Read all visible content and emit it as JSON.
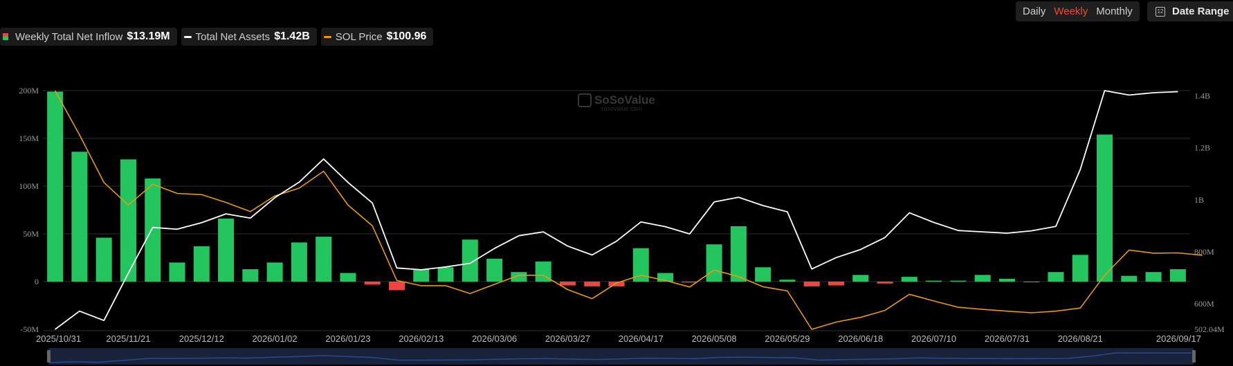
{
  "toolbar": {
    "daily": "Daily",
    "weekly": "Weekly",
    "monthly": "Monthly",
    "date_range": "Date Range",
    "calendar_day": "12"
  },
  "legend": [
    {
      "label": "Weekly Total Net Inflow",
      "value": "$13.19M"
    },
    {
      "label": "Total Net Assets",
      "value": "$1.42B"
    },
    {
      "label": "SOL Price",
      "value": "$100.96"
    }
  ],
  "watermark": {
    "brand": "SoSoValue",
    "url": "sosovalue.com"
  },
  "colors": {
    "positive": "#22c55e",
    "negative": "#ef4444",
    "assets_line": "#ffffff",
    "price_line": "#e69b12",
    "grid": "#2e2e2e",
    "active_tab": "#ef4a3c"
  },
  "chart_data": {
    "type": "bar",
    "title": "",
    "x_tick_labels": [
      "2025/10/31",
      "2025/11/21",
      "2025/12/12",
      "2026/01/02",
      "2026/01/23",
      "2026/02/13",
      "2026/03/06",
      "2026/03/27",
      "2026/04/17",
      "2026/05/08",
      "2026/05/29",
      "2026/06/18",
      "2026/07/10",
      "2026/07/31",
      "2026/08/21",
      "2026/09/17"
    ],
    "left_axis": {
      "ticks": [
        "-50M",
        "0",
        "50M",
        "100M",
        "150M",
        "200M"
      ],
      "range": [
        -50,
        200
      ],
      "unit": "M"
    },
    "right_axis": {
      "ticks": [
        "502.04M",
        "600M",
        "800M",
        "1B",
        "1.2B",
        "1.4B"
      ],
      "range": [
        502.04,
        1420
      ],
      "unit": "M"
    },
    "grid": true,
    "legend_position": "top-left",
    "series": [
      {
        "name": "Weekly Total Net Inflow",
        "type": "bar",
        "axis": "left",
        "values": [
          199,
          136,
          46,
          128,
          108,
          20,
          37,
          66,
          13,
          20,
          41,
          47,
          9,
          -3,
          -9,
          13,
          15,
          44,
          24,
          10,
          21,
          -4,
          -5,
          -5,
          35,
          9,
          -1,
          39,
          58,
          15,
          2,
          -5,
          -4,
          7,
          -2,
          5,
          1,
          1,
          7,
          3,
          0,
          10,
          28,
          154,
          6,
          10,
          13
        ]
      },
      {
        "name": "Total Net Assets",
        "type": "line",
        "axis": "right",
        "values": [
          502,
          572,
          536,
          718,
          894,
          887,
          912,
          946,
          930,
          1008,
          1068,
          1157,
          1067,
          988,
          738,
          731,
          742,
          756,
          813,
          862,
          877,
          822,
          788,
          841,
          915,
          897,
          869,
          992,
          1010,
          978,
          954,
          734,
          778,
          809,
          855,
          950,
          913,
          882,
          877,
          872,
          881,
          898,
          1117,
          1420,
          1403,
          1412,
          1416
        ]
      },
      {
        "name": "SOL Price",
        "type": "line",
        "axis": "right",
        "values": [
          1420,
          1250,
          1067,
          980,
          1060,
          1025,
          1020,
          990,
          955,
          1015,
          1045,
          1110,
          980,
          900,
          690,
          670,
          670,
          640,
          675,
          710,
          710,
          655,
          620,
          680,
          710,
          690,
          665,
          730,
          705,
          666,
          650,
          502,
          530,
          548,
          575,
          637,
          611,
          587,
          579,
          572,
          566,
          572,
          584,
          710,
          807,
          795,
          796,
          787
        ]
      }
    ]
  }
}
